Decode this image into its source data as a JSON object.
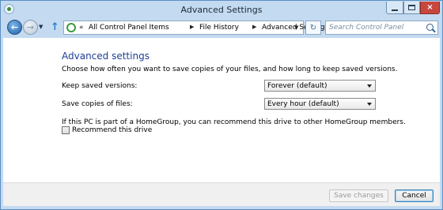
{
  "window": {
    "title": "Advanced Settings",
    "controls": {
      "minimize": "minimize",
      "maximize": "maximize",
      "close": "×"
    }
  },
  "navbar": {
    "back_glyph": "←",
    "forward_glyph": "→",
    "recent_glyph": "▼",
    "up_glyph": "↑",
    "address_prefix": "«",
    "breadcrumbs": [
      "All Control Panel Items",
      "File History",
      "Advanced Settings"
    ],
    "separator": "▶",
    "dropdown_glyph": "▼",
    "refresh_glyph": "↻",
    "search_placeholder": "Search Control Panel"
  },
  "content": {
    "heading": "Advanced settings",
    "intro": "Choose how often you want to save copies of your files, and how long to keep saved versions.",
    "keep_versions": {
      "label": "Keep saved versions:",
      "value": "Forever (default)"
    },
    "save_copies": {
      "label": "Save copies of files:",
      "value": "Every hour (default)"
    },
    "homegroup_text": "If this PC is part of a HomeGroup, you can recommend this drive to other HomeGroup members.",
    "recommend": {
      "label": "Recommend this drive",
      "checked": false
    }
  },
  "footer": {
    "save_label": "Save changes",
    "cancel_label": "Cancel"
  },
  "colors": {
    "frame": "#c3daf0",
    "heading": "#1e3f94",
    "close_button": "#c7473d"
  }
}
